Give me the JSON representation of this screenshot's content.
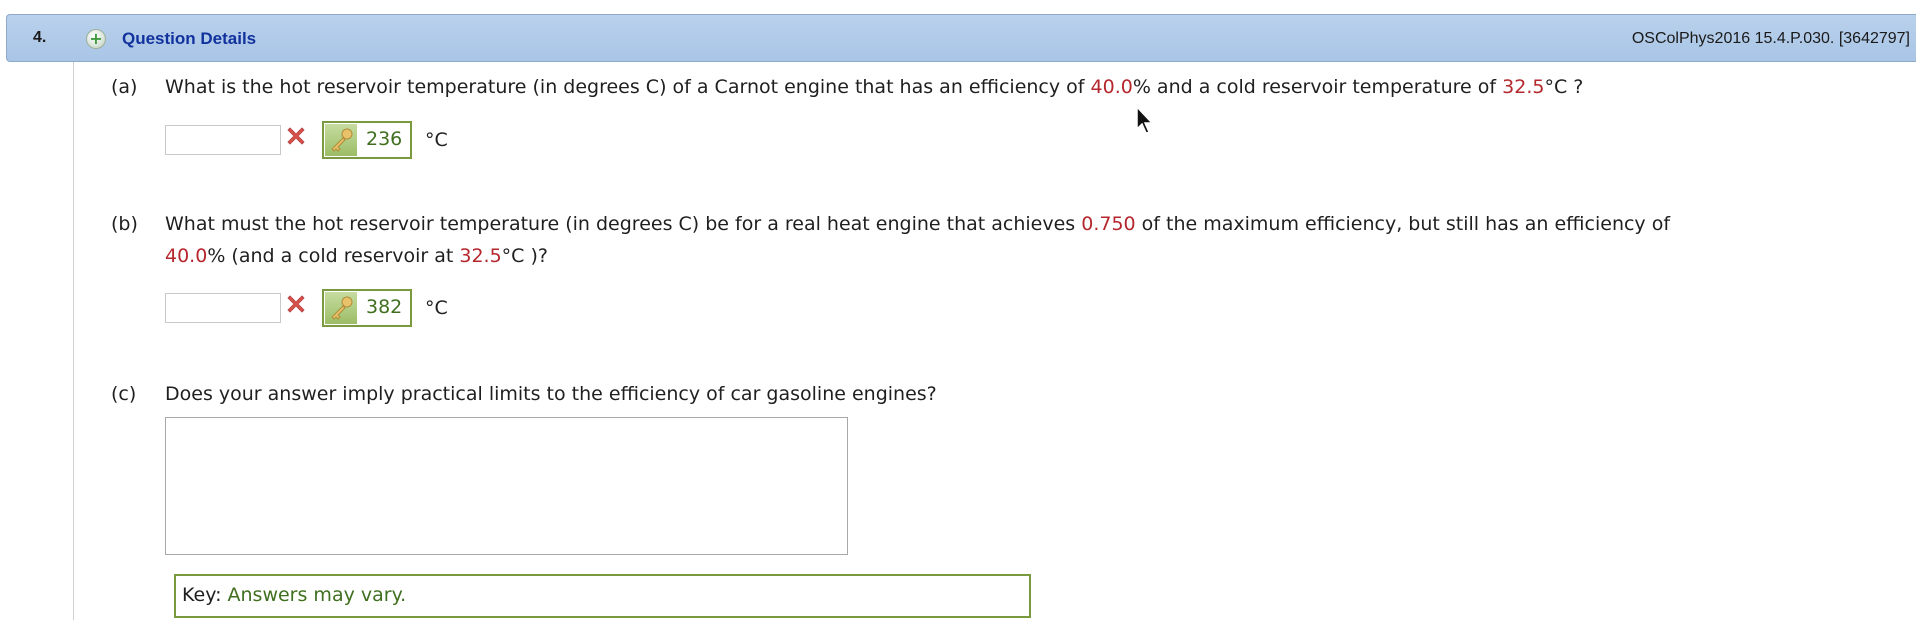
{
  "header": {
    "question_number": "4.",
    "title": "Question Details",
    "question_id": "OSColPhys2016 15.4.P.030. [3642797]"
  },
  "parts": {
    "a": {
      "label": "(a)",
      "text_1": "What is the hot reservoir temperature (in degrees C) of a Carnot engine that has an efficiency of ",
      "efficiency": "40.0",
      "text_2": "% and a cold reservoir temperature of ",
      "cold_temp": "32.5",
      "text_3": "°C ?",
      "input_value": "",
      "key_value": "236",
      "unit": "°C"
    },
    "b": {
      "label": "(b)",
      "text_1": "What must the hot reservoir temperature (in degrees C) be for a real heat engine that achieves ",
      "fraction": "0.750",
      "text_2": " of the maximum efficiency, but still has an efficiency of",
      "efficiency": "40.0",
      "text_3": "% (and a cold reservoir at ",
      "cold_temp": "32.5",
      "text_4": "°C )?",
      "input_value": "",
      "key_value": "382",
      "unit": "°C"
    },
    "c": {
      "label": "(c)",
      "text": "Does your answer imply practical limits to the efficiency of car gasoline engines?",
      "textarea_value": "",
      "key_label": "Key:",
      "key_text": "Answers may vary."
    }
  },
  "colors": {
    "header_bg": "#b0cae8",
    "title_blue": "#12329e",
    "value_red": "#b5272d",
    "key_green": "#3f6f1f",
    "key_border": "#7a9a3f"
  },
  "icons": {
    "expand": "plus-circle-icon",
    "incorrect": "x-mark-icon",
    "key": "key-icon",
    "cursor": "mouse-pointer-icon"
  }
}
